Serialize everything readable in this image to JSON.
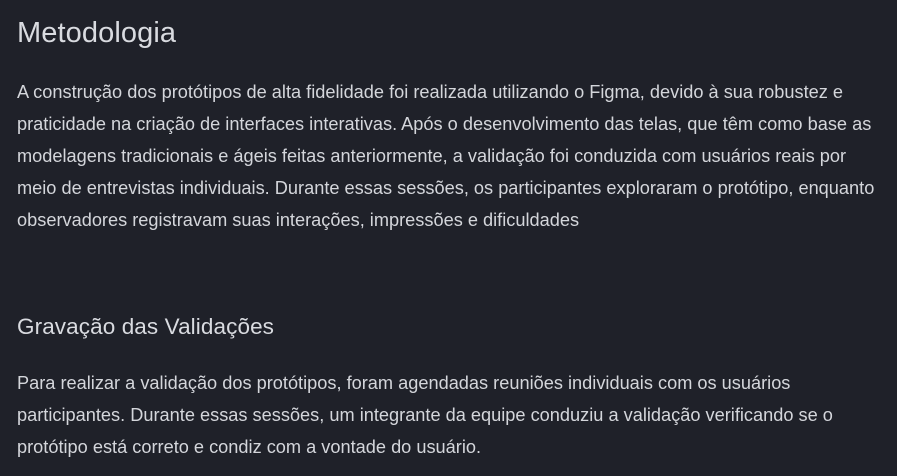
{
  "sections": [
    {
      "title": "Metodologia",
      "paragraph": "A construção dos protótipos de alta fidelidade foi realizada utilizando o Figma, devido à sua robustez e praticidade na criação de interfaces interativas. Após o desenvolvimento das telas, que têm como base as modelagens tradicionais e ágeis feitas anteriormente, a validação foi conduzida com usuários reais por meio de entrevistas individuais. Durante essas sessões, os participantes exploraram o protótipo, enquanto observadores registravam suas interações, impressões e dificuldades"
    },
    {
      "title": "Gravação das Validações",
      "paragraph": "Para realizar a validação dos protótipos, foram agendadas reuniões individuais com os usuários participantes. Durante essas sessões, um integrante da equipe conduziu a validação verificando se o protótipo está correto e condiz com a vontade do usuário."
    }
  ],
  "colors": {
    "background": "#1f2129",
    "text": "#d4d6db"
  }
}
